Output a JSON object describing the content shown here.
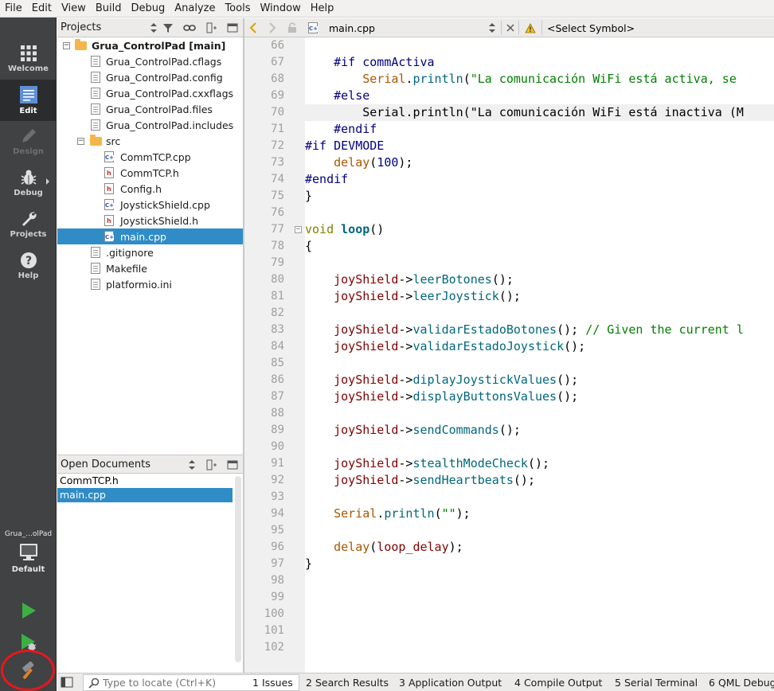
{
  "menu": [
    "File",
    "Edit",
    "View",
    "Build",
    "Debug",
    "Analyze",
    "Tools",
    "Window",
    "Help"
  ],
  "modes": [
    {
      "label": "Welcome",
      "icon": "grid-icon"
    },
    {
      "label": "Edit",
      "icon": "edit-document-icon"
    },
    {
      "label": "Design",
      "icon": "pencil-icon"
    },
    {
      "label": "Debug",
      "icon": "bug-icon"
    },
    {
      "label": "Projects",
      "icon": "wrench-icon"
    },
    {
      "label": "Help",
      "icon": "help-icon"
    }
  ],
  "kit": {
    "project_short": "Grua_...olPad",
    "build_config": "Default"
  },
  "projects_panel": {
    "title": "Projects",
    "tree": [
      {
        "label": "Grua_ControlPad [main]",
        "type": "folder",
        "level": 0,
        "expanded": true,
        "bold": true
      },
      {
        "label": "Grua_ControlPad.cflags",
        "type": "file",
        "level": 1
      },
      {
        "label": "Grua_ControlPad.config",
        "type": "file",
        "level": 1
      },
      {
        "label": "Grua_ControlPad.cxxflags",
        "type": "file",
        "level": 1
      },
      {
        "label": "Grua_ControlPad.files",
        "type": "file",
        "level": 1
      },
      {
        "label": "Grua_ControlPad.includes",
        "type": "file",
        "level": 1
      },
      {
        "label": "src",
        "type": "folder",
        "level": 1,
        "expanded": true
      },
      {
        "label": "CommTCP.cpp",
        "type": "cpp",
        "level": 2
      },
      {
        "label": "CommTCP.h",
        "type": "h",
        "level": 2
      },
      {
        "label": "Config.h",
        "type": "h",
        "level": 2
      },
      {
        "label": "JoystickShield.cpp",
        "type": "cpp",
        "level": 2
      },
      {
        "label": "JoystickShield.h",
        "type": "h",
        "level": 2
      },
      {
        "label": "main.cpp",
        "type": "cpp",
        "level": 2,
        "selected": true
      },
      {
        "label": ".gitignore",
        "type": "file",
        "level": 1
      },
      {
        "label": "Makefile",
        "type": "file",
        "level": 1
      },
      {
        "label": "platformio.ini",
        "type": "file",
        "level": 1
      }
    ]
  },
  "open_documents": {
    "title": "Open Documents",
    "items": [
      {
        "label": "CommTCP.h"
      },
      {
        "label": "main.cpp",
        "selected": true
      }
    ]
  },
  "editor": {
    "file_name": "main.cpp",
    "symbol": "<Select Symbol>",
    "lines": [
      {
        "n": 66,
        "tokens": []
      },
      {
        "n": 67,
        "tokens": [
          [
            "",
            "    "
          ],
          [
            "pp",
            "#if "
          ],
          [
            "pp",
            "commActiva"
          ]
        ]
      },
      {
        "n": 68,
        "tokens": [
          [
            "",
            "        "
          ],
          [
            "cls",
            "Serial"
          ],
          [
            "",
            "."
          ],
          [
            "fn",
            "println"
          ],
          [
            "",
            "("
          ],
          [
            "str",
            "\"La comunicación WiFi está activa, se"
          ]
        ]
      },
      {
        "n": 69,
        "tokens": [
          [
            "",
            "    "
          ],
          [
            "pp",
            "#else"
          ]
        ]
      },
      {
        "n": 70,
        "hl": true,
        "tokens": [
          [
            "",
            "        Serial.println(\"La comunicación WiFi está inactiva (M"
          ]
        ]
      },
      {
        "n": 71,
        "tokens": [
          [
            "",
            "    "
          ],
          [
            "pp",
            "#endif"
          ]
        ]
      },
      {
        "n": 72,
        "tokens": [
          [
            "pp",
            "#if DEVMODE"
          ]
        ]
      },
      {
        "n": 73,
        "tokens": [
          [
            "",
            "    "
          ],
          [
            "cls",
            "delay"
          ],
          [
            "",
            "("
          ],
          [
            "num",
            "100"
          ],
          [
            "",
            ");"
          ]
        ]
      },
      {
        "n": 74,
        "tokens": [
          [
            "pp",
            "#endif"
          ]
        ]
      },
      {
        "n": 75,
        "tokens": [
          [
            "",
            "}"
          ]
        ]
      },
      {
        "n": 76,
        "tokens": []
      },
      {
        "n": 77,
        "fold": true,
        "tokens": [
          [
            "kw",
            "void"
          ],
          [
            "",
            " "
          ],
          [
            "bold",
            "loop"
          ],
          [
            "",
            "()"
          ]
        ]
      },
      {
        "n": 78,
        "tokens": [
          [
            "",
            "{"
          ]
        ]
      },
      {
        "n": 79,
        "tokens": []
      },
      {
        "n": 80,
        "tokens": [
          [
            "",
            "    "
          ],
          [
            "id",
            "joyShield"
          ],
          [
            "",
            "->"
          ],
          [
            "fn",
            "leerBotones"
          ],
          [
            "",
            "();"
          ]
        ]
      },
      {
        "n": 81,
        "tokens": [
          [
            "",
            "    "
          ],
          [
            "id",
            "joyShield"
          ],
          [
            "",
            "->"
          ],
          [
            "fn",
            "leerJoystick"
          ],
          [
            "",
            "();"
          ]
        ]
      },
      {
        "n": 82,
        "tokens": []
      },
      {
        "n": 83,
        "tokens": [
          [
            "",
            "    "
          ],
          [
            "id",
            "joyShield"
          ],
          [
            "",
            "->"
          ],
          [
            "fn",
            "validarEstadoBotones"
          ],
          [
            "",
            "(); "
          ],
          [
            "cmt",
            "// Given the current l"
          ]
        ]
      },
      {
        "n": 84,
        "tokens": [
          [
            "",
            "    "
          ],
          [
            "id",
            "joyShield"
          ],
          [
            "",
            "->"
          ],
          [
            "fn",
            "validarEstadoJoystick"
          ],
          [
            "",
            "();"
          ]
        ]
      },
      {
        "n": 85,
        "tokens": []
      },
      {
        "n": 86,
        "tokens": [
          [
            "",
            "    "
          ],
          [
            "id",
            "joyShield"
          ],
          [
            "",
            "->"
          ],
          [
            "fn",
            "diplayJoystickValues"
          ],
          [
            "",
            "();"
          ]
        ]
      },
      {
        "n": 87,
        "tokens": [
          [
            "",
            "    "
          ],
          [
            "id",
            "joyShield"
          ],
          [
            "",
            "->"
          ],
          [
            "fn",
            "displayButtonsValues"
          ],
          [
            "",
            "();"
          ]
        ]
      },
      {
        "n": 88,
        "tokens": []
      },
      {
        "n": 89,
        "tokens": [
          [
            "",
            "    "
          ],
          [
            "id",
            "joyShield"
          ],
          [
            "",
            "->"
          ],
          [
            "fn",
            "sendCommands"
          ],
          [
            "",
            "();"
          ]
        ]
      },
      {
        "n": 90,
        "tokens": []
      },
      {
        "n": 91,
        "tokens": [
          [
            "",
            "    "
          ],
          [
            "id",
            "joyShield"
          ],
          [
            "",
            "->"
          ],
          [
            "fn",
            "stealthModeCheck"
          ],
          [
            "",
            "();"
          ]
        ]
      },
      {
        "n": 92,
        "tokens": [
          [
            "",
            "    "
          ],
          [
            "id",
            "joyShield"
          ],
          [
            "",
            "->"
          ],
          [
            "fn",
            "sendHeartbeats"
          ],
          [
            "",
            "();"
          ]
        ]
      },
      {
        "n": 93,
        "tokens": []
      },
      {
        "n": 94,
        "tokens": [
          [
            "",
            "    "
          ],
          [
            "cls",
            "Serial"
          ],
          [
            "",
            "."
          ],
          [
            "fn",
            "println"
          ],
          [
            "",
            "("
          ],
          [
            "str",
            "\"\""
          ],
          [
            "",
            ");"
          ]
        ]
      },
      {
        "n": 95,
        "tokens": []
      },
      {
        "n": 96,
        "tokens": [
          [
            "",
            "    "
          ],
          [
            "cls",
            "delay"
          ],
          [
            "",
            "("
          ],
          [
            "id",
            "loop_delay"
          ],
          [
            "",
            ");"
          ]
        ]
      },
      {
        "n": 97,
        "tokens": [
          [
            "",
            "}"
          ]
        ]
      },
      {
        "n": 98,
        "tokens": []
      },
      {
        "n": 99,
        "tokens": []
      },
      {
        "n": 100,
        "tokens": []
      },
      {
        "n": 101,
        "tokens": []
      },
      {
        "n": 102,
        "tokens": []
      }
    ]
  },
  "statusbar": {
    "locator_placeholder": "Type to locate (Ctrl+K)",
    "tabs": [
      {
        "num": "1",
        "label": "Issues"
      },
      {
        "num": "2",
        "label": "Search Results"
      },
      {
        "num": "3",
        "label": "Application Output"
      },
      {
        "num": "4",
        "label": "Compile Output"
      },
      {
        "num": "5",
        "label": "Serial Terminal"
      },
      {
        "num": "6",
        "label": "QML Debug"
      }
    ]
  },
  "colors": {
    "mode_bar": "#404244",
    "selection": "#308cc6",
    "annotation_circle": "#e8171a",
    "run_green": "#3cb043"
  }
}
